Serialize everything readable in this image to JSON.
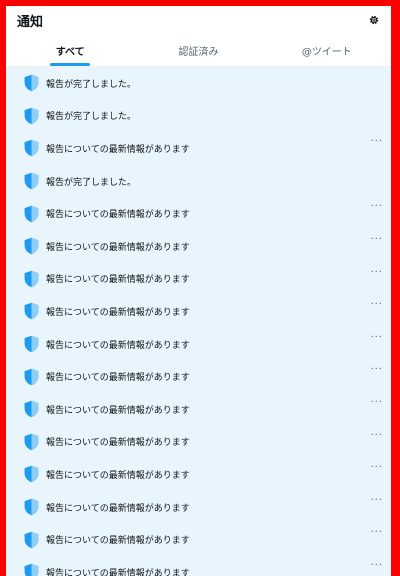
{
  "header": {
    "title": "通知"
  },
  "tabs": [
    {
      "label": "すべて"
    },
    {
      "label": "認証済み"
    },
    {
      "label": "@ツイート"
    }
  ],
  "colors": {
    "accent": "#1d9bf0",
    "shield": "#1d9bf0",
    "unread_bg": "#e8f5fd",
    "frame": "#ff0000"
  },
  "icons": {
    "settings": "gear-icon",
    "item": "shield-icon",
    "menu": "more-icon"
  },
  "more_glyph": "···",
  "notifications": [
    {
      "text": "報告が完了しました。",
      "has_menu": false
    },
    {
      "text": "報告が完了しました。",
      "has_menu": false
    },
    {
      "text": "報告についての最新情報があります",
      "has_menu": true
    },
    {
      "text": "報告が完了しました。",
      "has_menu": false
    },
    {
      "text": "報告についての最新情報があります",
      "has_menu": true
    },
    {
      "text": "報告についての最新情報があります",
      "has_menu": true
    },
    {
      "text": "報告についての最新情報があります",
      "has_menu": true
    },
    {
      "text": "報告についての最新情報があります",
      "has_menu": true
    },
    {
      "text": "報告についての最新情報があります",
      "has_menu": true
    },
    {
      "text": "報告についての最新情報があります",
      "has_menu": true
    },
    {
      "text": "報告についての最新情報があります",
      "has_menu": true
    },
    {
      "text": "報告についての最新情報があります",
      "has_menu": true
    },
    {
      "text": "報告についての最新情報があります",
      "has_menu": true
    },
    {
      "text": "報告についての最新情報があります",
      "has_menu": true
    },
    {
      "text": "報告についての最新情報があります",
      "has_menu": true
    },
    {
      "text": "報告についての最新情報があります",
      "has_menu": true
    }
  ]
}
